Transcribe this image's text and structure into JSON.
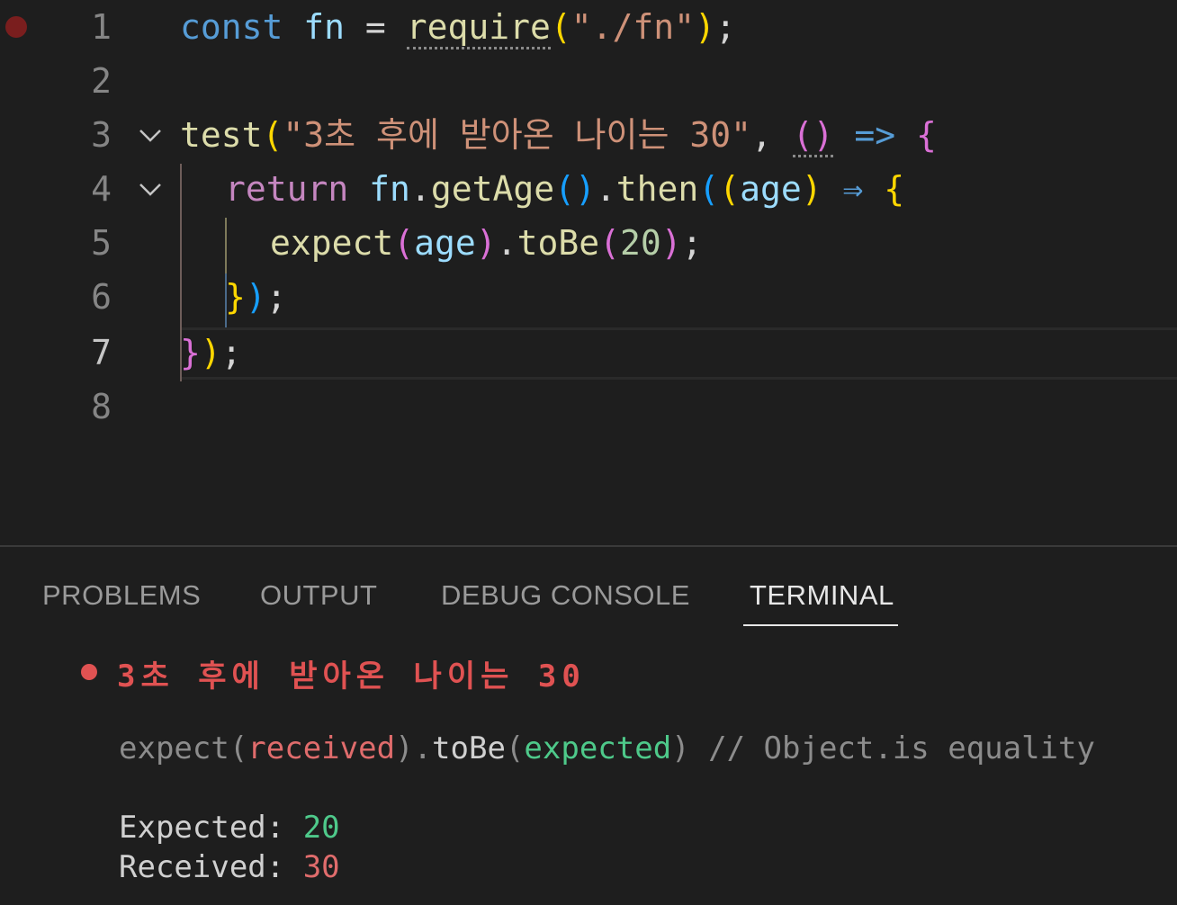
{
  "editor": {
    "line_numbers": [
      "1",
      "2",
      "3",
      "4",
      "5",
      "6",
      "7",
      "8"
    ],
    "lines": {
      "l1": {
        "kw_const": "const",
        "sp1": " ",
        "var_fn": "fn",
        "eq": " = ",
        "fn_require": "require",
        "paren_open": "(",
        "str_path": "\"./fn\"",
        "paren_close": ")",
        "semi": ";"
      },
      "l3": {
        "fn_test": "test",
        "paren_open": "(",
        "str_name": "\"3초 후에 받아온 나이는 30\"",
        "comma": ", ",
        "arrow_parens": "()",
        "arrow": " => ",
        "brace_open": "{"
      },
      "l4": {
        "ctrl_return": "return",
        "sp1": " ",
        "var_fn": "fn",
        "dot1": ".",
        "fn_getAge": "getAge",
        "getAge_parens": "()",
        "dot2": ".",
        "fn_then": "then",
        "paren_open": "(",
        "inner_paren_open": "(",
        "param_age": "age",
        "inner_paren_close": ")",
        "arrow": " ⇒ ",
        "brace_open": "{"
      },
      "l5": {
        "fn_expect": "expect",
        "paren_open": "(",
        "var_age": "age",
        "paren_close": ")",
        "dot": ".",
        "fn_toBe": "toBe",
        "paren2_open": "(",
        "num_20": "20",
        "paren2_close": ")",
        "semi": ";"
      },
      "l6": {
        "brace_close": "}",
        "paren_close": ")",
        "semi": ";"
      },
      "l7": {
        "brace_close": "}",
        "paren_close": ")",
        "semi": ";"
      }
    }
  },
  "panel": {
    "tabs": [
      "PROBLEMS",
      "OUTPUT",
      "DEBUG CONSOLE",
      "TERMINAL"
    ],
    "active_tab": "TERMINAL",
    "terminal": {
      "fail_title": "3초 후에 받아온 나이는 30",
      "assert_line": {
        "expect": "expect(",
        "received": "received",
        "close1": ")",
        "dot": ".",
        "toBe": "toBe",
        "open2": "(",
        "expected": "expected",
        "close2": ")",
        "comment": " // Object.is equality"
      },
      "expected_label": "Expected: ",
      "expected_value": "20",
      "received_label": "Received: ",
      "received_value": "30"
    }
  },
  "colors": {
    "background": "#1e1e1e",
    "keyword": "#569cd6",
    "control": "#c586c0",
    "function": "#dcdcaa",
    "string": "#ce9178",
    "number": "#b5cea8",
    "variable": "#9cdcfe",
    "error": "#e05252",
    "pass": "#4ec98a"
  }
}
